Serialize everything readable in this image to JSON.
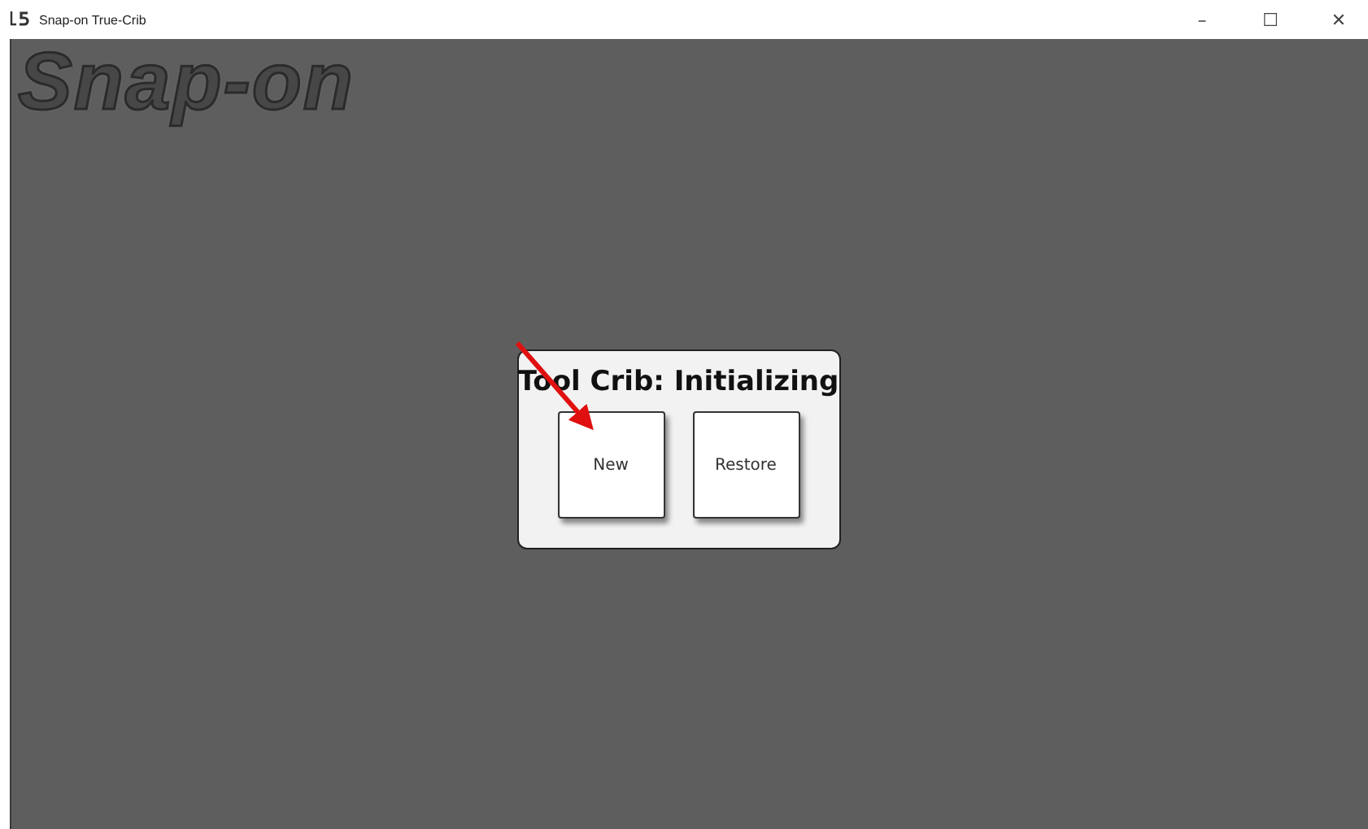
{
  "window": {
    "title": "Snap-on True-Crib",
    "controls": [
      "–",
      "☐",
      "✕"
    ]
  },
  "logo": {
    "text": "Snap-on"
  },
  "dialog": {
    "title": "Tool Crib: Initializing",
    "buttons": [
      {
        "label": "New"
      },
      {
        "label": "Restore"
      }
    ]
  }
}
